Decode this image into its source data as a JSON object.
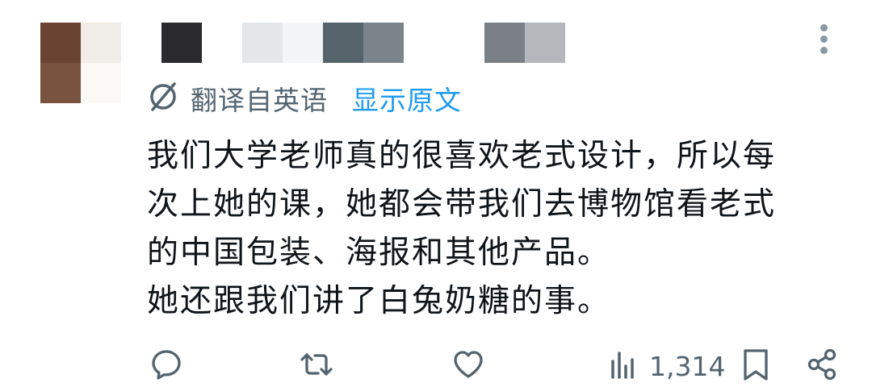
{
  "tweet": {
    "translation_notice": "翻译自英语",
    "show_original_label": "显示原文",
    "body_lines": [
      "我们大学老师真的很喜欢老式设计，所以每",
      "次上她的课，她都会带我们去博物馆看老式",
      "的中国包装、海报和其他产品。",
      "她还跟我们讲了白兔奶糖的事。"
    ]
  },
  "actions": {
    "views_count": "1,314"
  },
  "icons": {
    "translate": "globe-slash-icon",
    "reply": "speech-bubble-icon",
    "retweet": "retweet-icon",
    "like": "heart-icon",
    "views": "bar-chart-icon",
    "bookmark": "bookmark-icon",
    "share": "share-icon",
    "menu": "more-vertical-icon"
  },
  "colors": {
    "link": "#1d9bf0",
    "muted": "#536471",
    "text": "#0f1419"
  }
}
